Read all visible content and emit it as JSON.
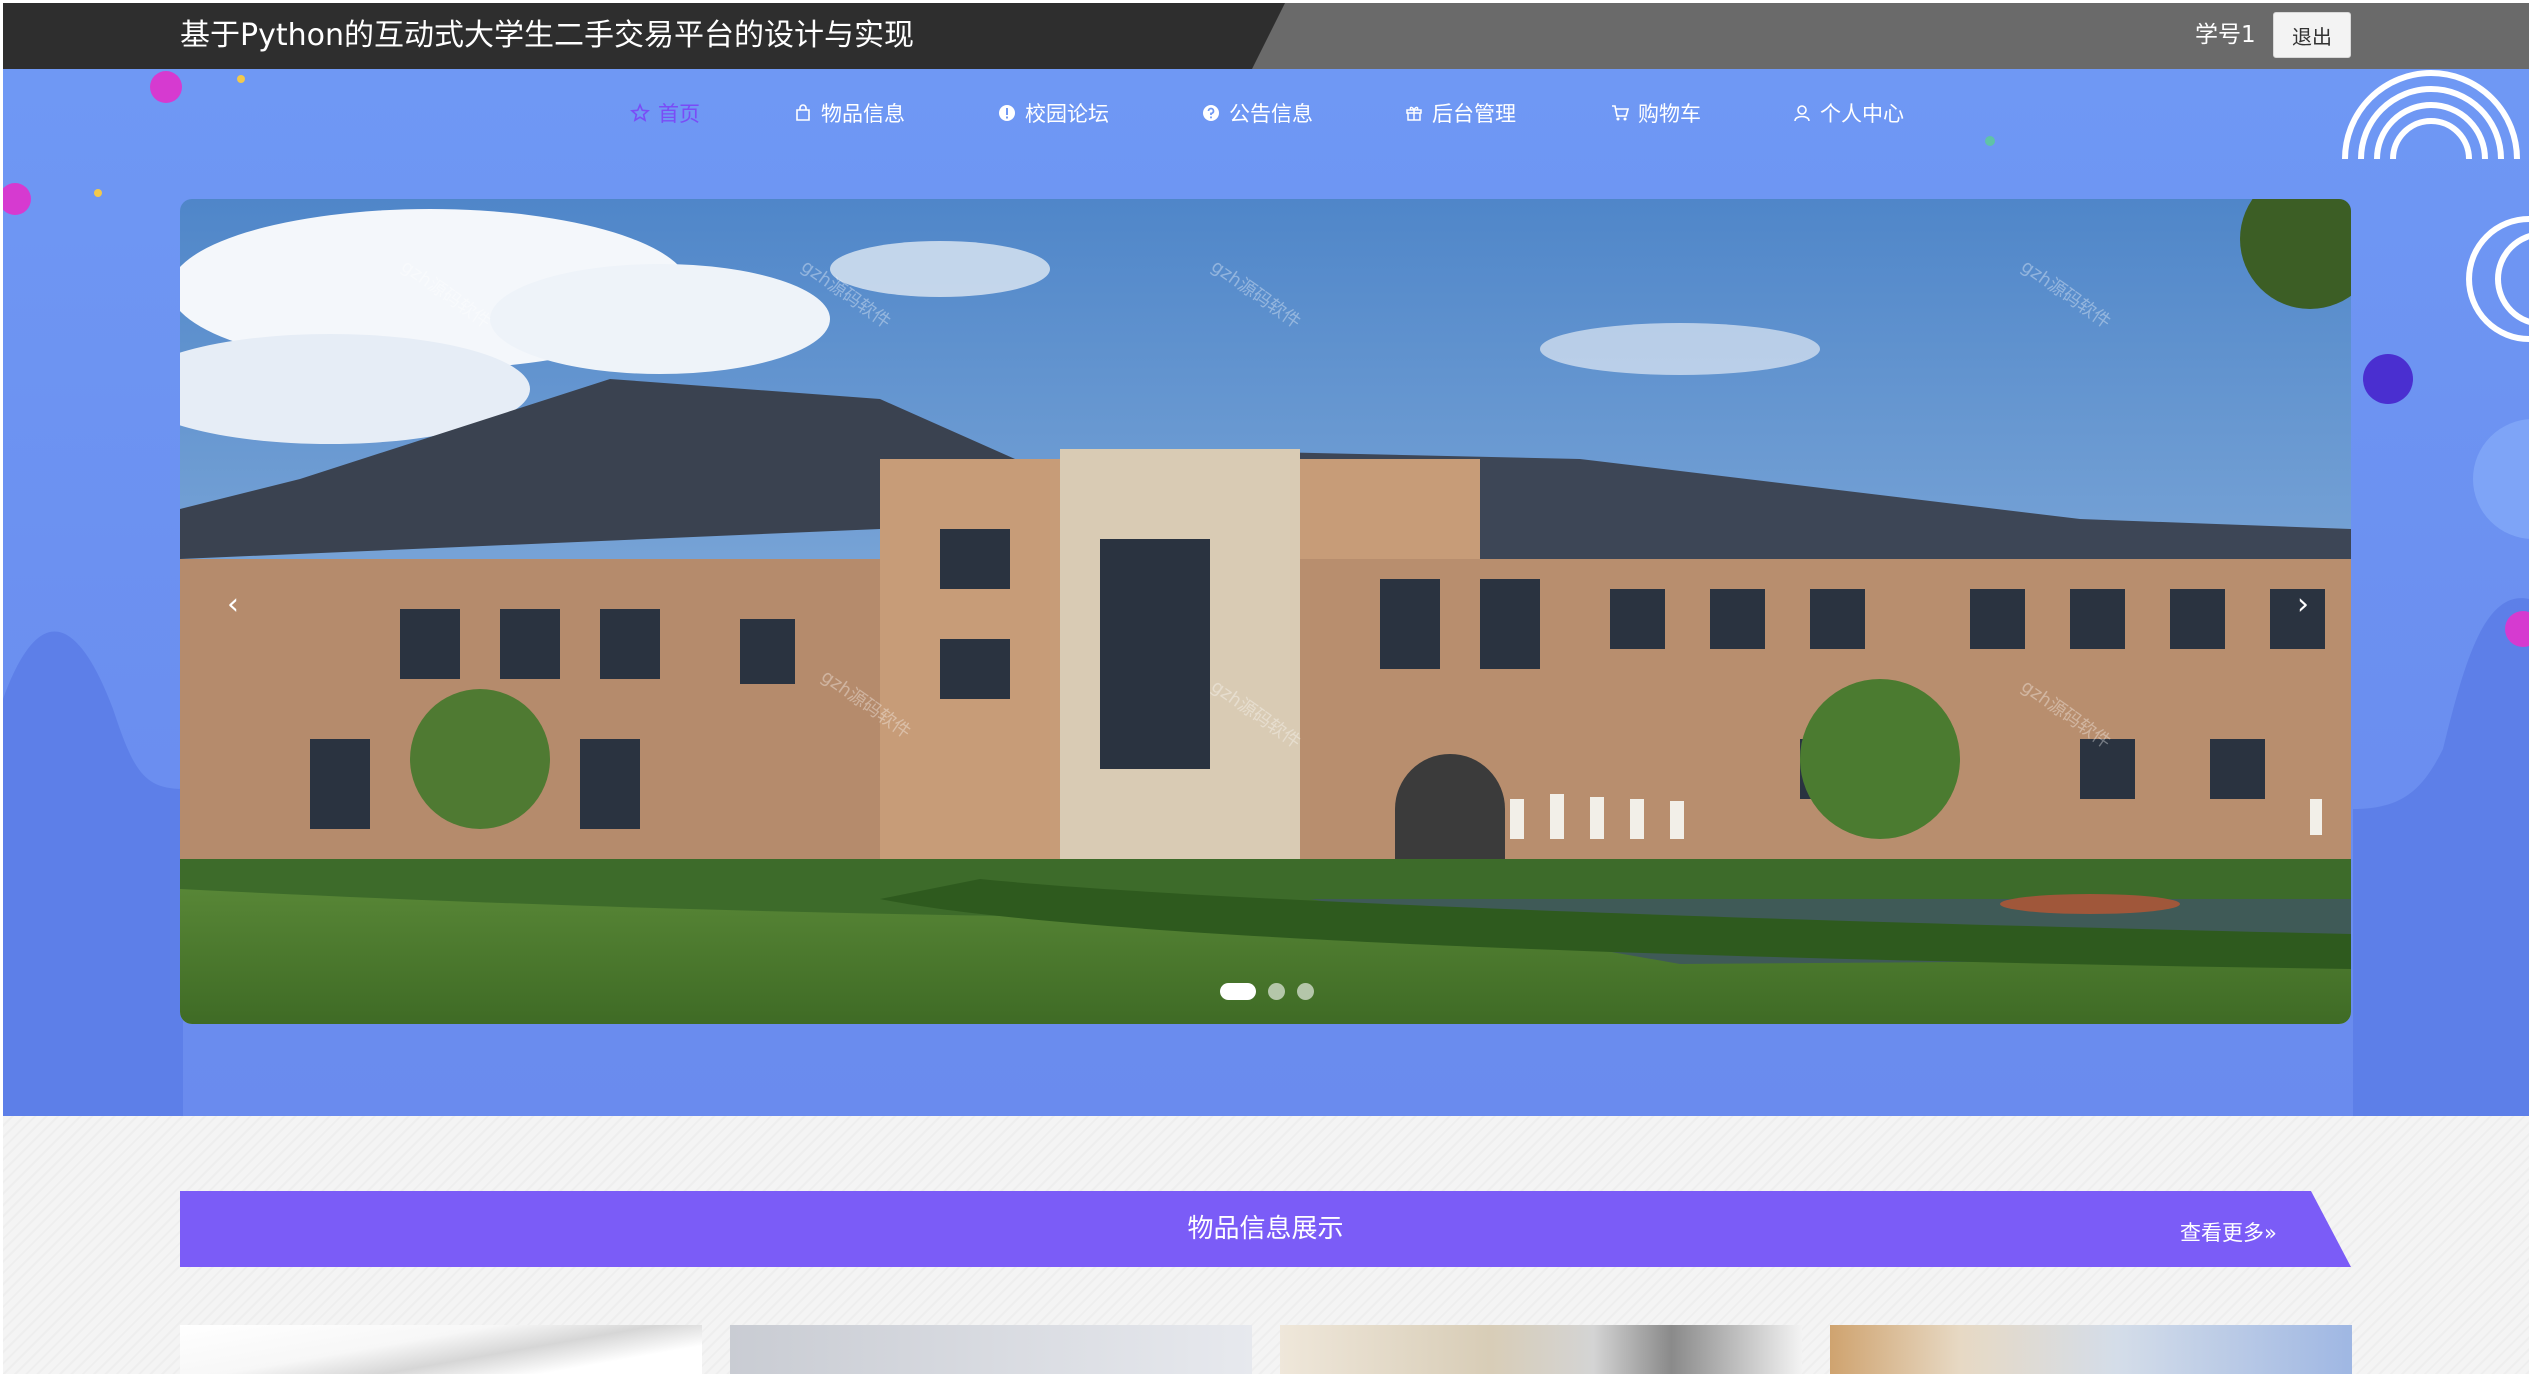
{
  "header": {
    "site_title": "基于Python的互动式大学生二手交易平台的设计与实现",
    "user_name": "学号1",
    "logout_label": "退出"
  },
  "nav": {
    "items": [
      {
        "label": "首页",
        "icon": "star-icon",
        "active": true
      },
      {
        "label": "物品信息",
        "icon": "bag-icon",
        "active": false
      },
      {
        "label": "校园论坛",
        "icon": "info-circle-icon",
        "active": false
      },
      {
        "label": "公告信息",
        "icon": "question-circle-icon",
        "active": false
      },
      {
        "label": "后台管理",
        "icon": "gift-icon",
        "active": false
      },
      {
        "label": "购物车",
        "icon": "cart-icon",
        "active": false
      },
      {
        "label": "个人中心",
        "icon": "user-icon",
        "active": false
      }
    ]
  },
  "carousel": {
    "prev_glyph": "‹",
    "next_glyph": "›",
    "slide_count": 3,
    "active_index": 0
  },
  "product_section": {
    "title": "物品信息展示",
    "more_label": "查看更多"
  },
  "colors": {
    "topbar_dark": "#2e2e2e",
    "topbar_light": "#6a6a6a",
    "hero_blue": "#6f98f4",
    "accent_purple": "#7b5cf7",
    "nav_active": "#7a4cf6"
  }
}
